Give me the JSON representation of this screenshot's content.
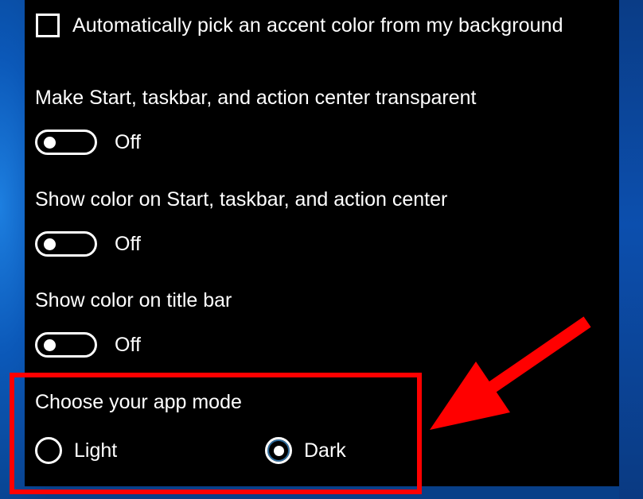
{
  "accent": {
    "auto_pick_label": "Automatically pick an accent color from my background",
    "auto_pick_checked": false
  },
  "settings": [
    {
      "title": "Make Start, taskbar, and action center transparent",
      "state": "Off"
    },
    {
      "title": "Show color on Start, taskbar, and action center",
      "state": "Off"
    },
    {
      "title": "Show color on title bar",
      "state": "Off"
    }
  ],
  "app_mode": {
    "title": "Choose your app mode",
    "options": [
      {
        "label": "Light",
        "selected": false
      },
      {
        "label": "Dark",
        "selected": true
      }
    ]
  },
  "colors": {
    "panel_bg": "#000000",
    "text": "#ffffff",
    "annotation": "#ff0000",
    "wallpaper": "#0b58b8"
  },
  "icons": [
    "checkbox-icon",
    "toggle-switch-icon",
    "radio-button-icon",
    "arrow-annotation-icon"
  ]
}
